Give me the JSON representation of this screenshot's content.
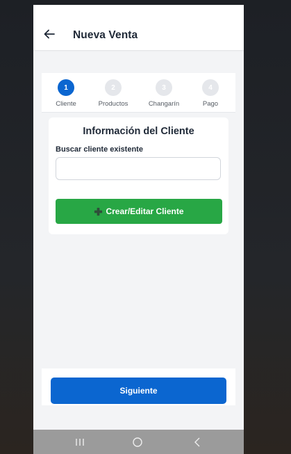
{
  "header": {
    "title": "Nueva Venta",
    "back_icon": "arrow-left-icon"
  },
  "stepper": {
    "steps": [
      {
        "number": "1",
        "label": "Cliente",
        "active": true
      },
      {
        "number": "2",
        "label": "Productos",
        "active": false
      },
      {
        "number": "3",
        "label": "Changarín",
        "active": false
      },
      {
        "number": "4",
        "label": "Pago",
        "active": false
      }
    ],
    "active_color": "#0b66d0",
    "inactive_color": "#e5e7eb"
  },
  "client_card": {
    "title": "Información del Cliente",
    "search_label": "Buscar cliente existente",
    "search_value": "",
    "create_icon": "plus-icon",
    "create_label": "Crear/Editar Cliente",
    "create_color": "#28a745"
  },
  "footer": {
    "next_label": "Siguiente",
    "next_color": "#0b66d0"
  },
  "system_nav": {
    "icons": [
      "recent-apps-icon",
      "home-icon",
      "back-icon"
    ]
  }
}
